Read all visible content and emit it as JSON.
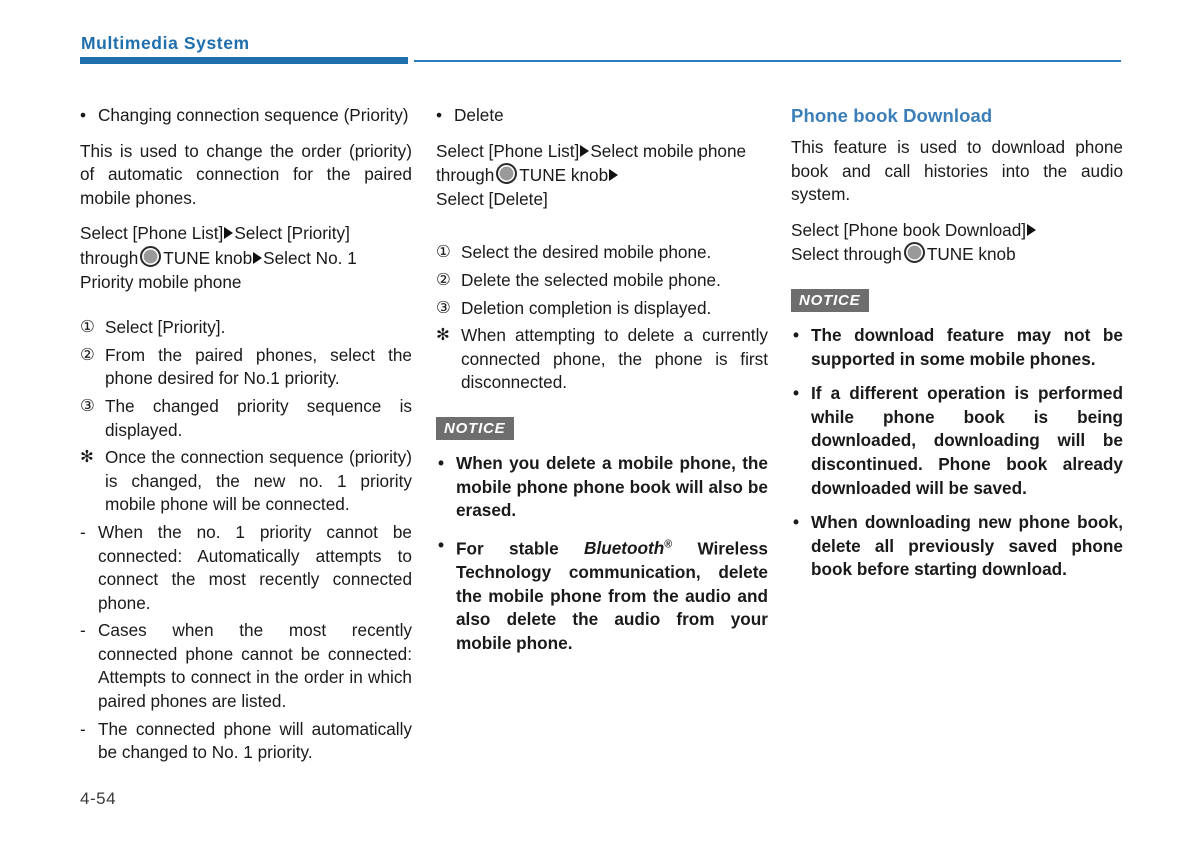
{
  "header": {
    "title": "Multimedia System",
    "accent_color": "#1f6fad"
  },
  "footer": {
    "page_number": "4-54"
  },
  "icons": {
    "tune_knob": "tune-knob-icon",
    "step_arrow": "step-arrow-icon"
  },
  "column1": {
    "bullet_heading": {
      "marker": "•",
      "text": "Changing connection sequence (Priority)"
    },
    "intro": "This is used to change the order (priority) of automatic connection for the paired mobile phones.",
    "path": {
      "part1": "Select [Phone List]",
      "part2": "Select [Priority] through",
      "part3": "TUNE knob",
      "part4": "Select No. 1 Priority mobile phone"
    },
    "steps": [
      {
        "marker": "①",
        "text": "Select [Priority]."
      },
      {
        "marker": "②",
        "text": "From the paired phones, select the phone desired for No.1 priority."
      },
      {
        "marker": "③",
        "text": "The changed priority sequence is displayed."
      },
      {
        "marker": "✻",
        "text": "Once the connection sequence (priority) is changed, the new no. 1 priority mobile phone will be connected."
      }
    ],
    "dash_items": [
      {
        "marker": "-",
        "text": "When the no. 1 priority cannot be connected: Automatically attempts to connect the most recently connected phone."
      },
      {
        "marker": "-",
        "text": "Cases when the most recently connected phone cannot be connected: Attempts to connect in the order in which paired phones are listed."
      },
      {
        "marker": "-",
        "text": "The connected phone will automatically be changed to No. 1 priority."
      }
    ]
  },
  "column2": {
    "bullet_heading": {
      "marker": "•",
      "text": "Delete"
    },
    "path": {
      "part1": "Select [Phone List]",
      "part2": "Select mobile phone through",
      "part3": "TUNE knob",
      "part4": "Select [Delete]"
    },
    "steps": [
      {
        "marker": "①",
        "text": "Select the desired mobile phone."
      },
      {
        "marker": "②",
        "text": "Delete the selected mobile phone."
      },
      {
        "marker": "③",
        "text": "Deletion completion is displayed."
      },
      {
        "marker": "✻",
        "text": "When attempting to delete a currently connected phone, the phone is first disconnected."
      }
    ],
    "notice": {
      "label": "NOTICE",
      "bullets": [
        {
          "marker": "•",
          "text": "When you delete a mobile phone, the mobile phone phone book will also be erased."
        },
        {
          "marker": "•",
          "text_before": "For stable ",
          "trademark": "Bluetooth",
          "trademark_sup": "®",
          "text_after": " Wireless Technology   communication, delete the mobile phone from the audio and also delete the audio from your mobile phone."
        }
      ]
    }
  },
  "column3": {
    "heading": "Phone book Download",
    "intro": "This feature is used to download phone book and call histories into the audio system.",
    "path": {
      "part1": "Select [Phone book Download]",
      "part2": "Select through",
      "part3": "TUNE knob"
    },
    "notice": {
      "label": "NOTICE",
      "bullets": [
        {
          "marker": "•",
          "text": "The download feature may not be supported in some mobile phones."
        },
        {
          "marker": "•",
          "text": "If a different operation is performed while phone book is being downloaded, downloading will be discontinued. Phone book already downloaded will be saved."
        },
        {
          "marker": "•",
          "text": "When downloading new phone book, delete all previously saved phone book before starting download."
        }
      ]
    }
  }
}
